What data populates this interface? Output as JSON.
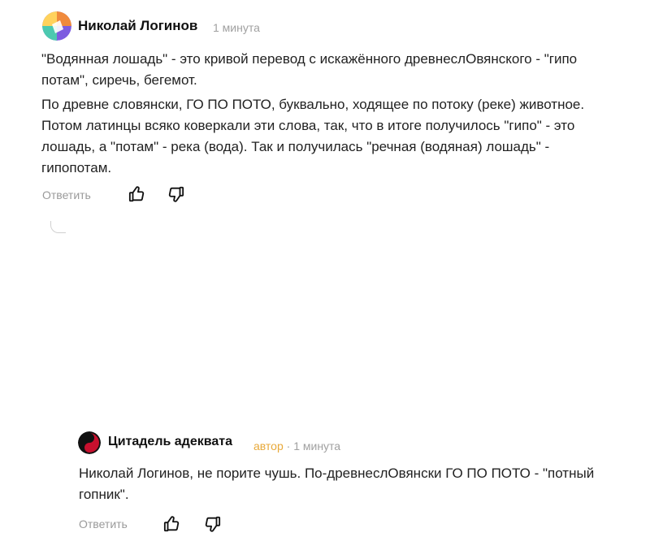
{
  "comments": [
    {
      "author": "Николай Логинов",
      "time": "1 минута",
      "paragraphs": [
        "\"Водянная лошадь\" - это кривой перевод с искажённого древнеслОвянского - \"гипо потам\", сиречь, бегемот.",
        "По древне словянски, ГО ПО ПОТО, буквально, ходящее по потоку (реке) животное. Потом латинцы всяко коверкали эти слова, так, что в итоге получилось \"гипо\" - это лошадь, а \"потам\" - река (вода). Так и получилась \"речная (водяная) лошадь\" - гипопотам."
      ],
      "reply_label": "Ответить"
    },
    {
      "author": "Цитадель адеквата",
      "badge": "автор",
      "separator": "·",
      "time": "1 минута",
      "paragraphs": [
        "Николай Логинов, не порите чушь. По-древнеслОвянски ГО ПО ПОТО - \"потный гопник\"."
      ],
      "reply_label": "Ответить"
    }
  ],
  "colors": {
    "author_badge": "#e8a93a",
    "meta": "#a0a0a0"
  },
  "icons": [
    "thumbs-up-icon",
    "thumbs-down-icon"
  ]
}
